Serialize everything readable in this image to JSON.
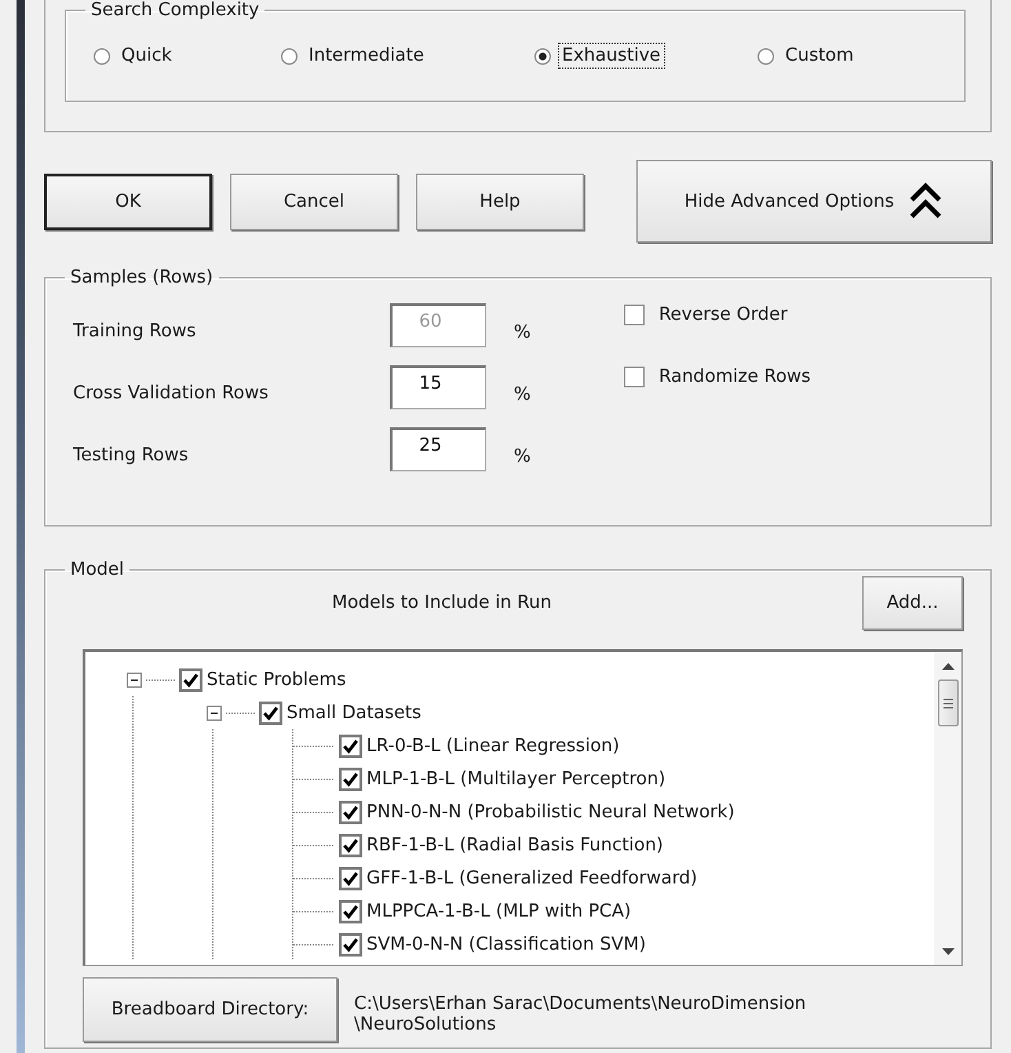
{
  "search_complexity": {
    "title": "Search Complexity",
    "options": [
      {
        "label": "Quick",
        "selected": false,
        "focused": false
      },
      {
        "label": "Intermediate",
        "selected": false,
        "focused": false
      },
      {
        "label": "Exhaustive",
        "selected": true,
        "focused": true
      },
      {
        "label": "Custom",
        "selected": false,
        "focused": false
      }
    ]
  },
  "buttons": [
    {
      "label": "OK",
      "default": true
    },
    {
      "label": "Cancel",
      "default": false
    },
    {
      "label": "Help",
      "default": false
    }
  ],
  "advanced_button": {
    "label": "Hide Advanced Options"
  },
  "samples": {
    "title": "Samples (Rows)",
    "unit": "%",
    "rows": [
      {
        "label": "Training Rows",
        "value": "60",
        "disabled": true
      },
      {
        "label": "Cross Validation Rows",
        "value": "15",
        "disabled": false
      },
      {
        "label": "Testing Rows",
        "value": "25",
        "disabled": false
      }
    ],
    "options": [
      {
        "label": "Reverse Order",
        "checked": false
      },
      {
        "label": "Randomize Rows",
        "checked": false
      }
    ]
  },
  "model": {
    "title": "Model",
    "caption": "Models to Include in Run",
    "add_button": "Add...",
    "tree": [
      {
        "label": "Static Problems",
        "checked": true,
        "expanded": true,
        "children": [
          {
            "label": "Small Datasets",
            "checked": true,
            "expanded": true,
            "children": [
              {
                "label": "LR-0-B-L (Linear Regression)",
                "checked": true
              },
              {
                "label": "MLP-1-B-L (Multilayer Perceptron)",
                "checked": true
              },
              {
                "label": "PNN-0-N-N (Probabilistic Neural Network)",
                "checked": true
              },
              {
                "label": "RBF-1-B-L (Radial Basis Function)",
                "checked": true
              },
              {
                "label": "GFF-1-B-L (Generalized Feedforward)",
                "checked": true
              },
              {
                "label": "MLPPCA-1-B-L (MLP with PCA)",
                "checked": true
              },
              {
                "label": "SVM-0-N-N (Classification SVM)",
                "checked": true
              }
            ]
          }
        ]
      }
    ],
    "directory_button": "Breadboard Directory:",
    "directory_path": [
      "C:\\Users\\Erhan Sarac\\Documents\\NeuroDimension",
      "\\NeuroSolutions"
    ]
  }
}
